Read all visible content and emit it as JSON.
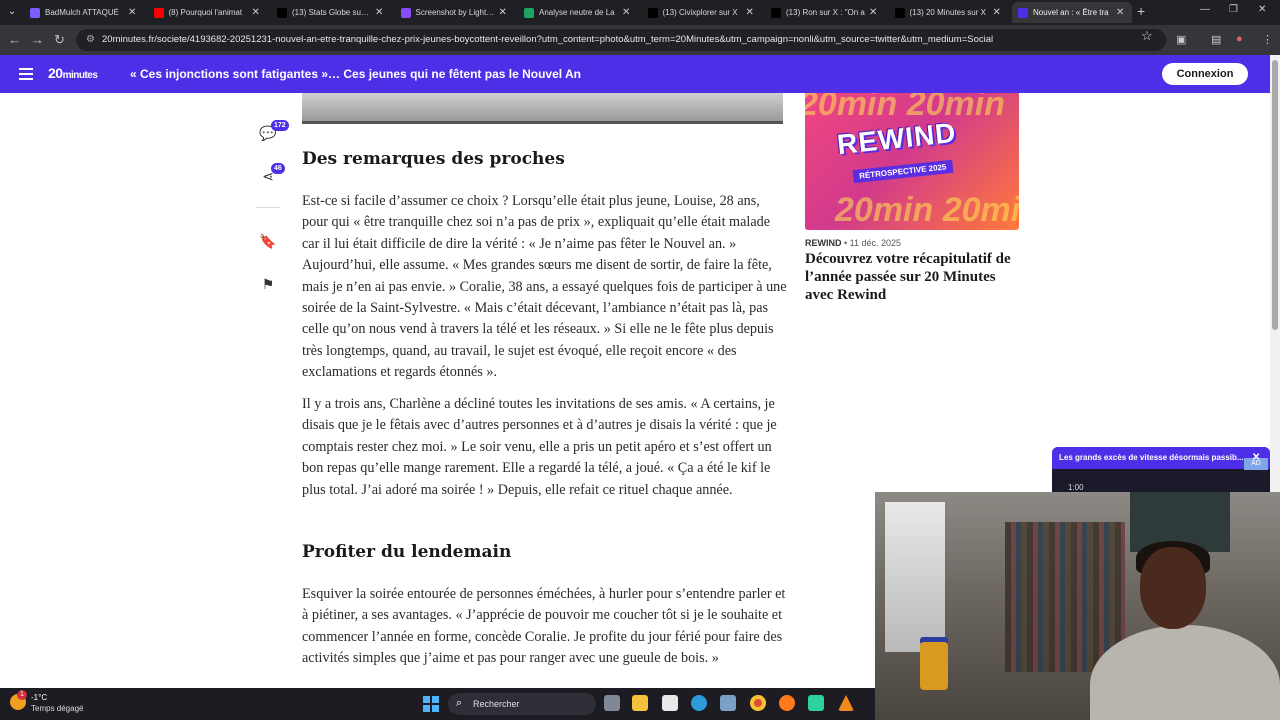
{
  "browser": {
    "tabs": [
      {
        "title": "BadMulch ATTAQUÉ",
        "color": "#7b5cff"
      },
      {
        "title": "(8) Pourquoi l'animat",
        "color": "#ff0000"
      },
      {
        "title": "(13) Stats Globe sur X",
        "color": "#000000"
      },
      {
        "title": "Screenshot by Lightsh",
        "color": "#8a4cf5"
      },
      {
        "title": "Analyse neutre de La",
        "color": "#1fa463"
      },
      {
        "title": "(13) Civixplorer sur X",
        "color": "#000000"
      },
      {
        "title": "(13) Ron sur X : \"On a",
        "color": "#000000"
      },
      {
        "title": "(13) 20 Minutes sur X",
        "color": "#000000"
      },
      {
        "title": "Nouvel an : « Être tra",
        "color": "#4f2ee8",
        "active": true
      }
    ],
    "url": "20minutes.fr/societe/4193682-20251231-nouvel-an-etre-tranquille-chez-prix-jeunes-boycottent-reveillon?utm_content=photo&utm_term=20Minutes&utm_campaign=nonli&utm_source=twitter&utm_medium=Social"
  },
  "site": {
    "logo_main": "20",
    "logo_sub": "minutes",
    "header_title": "« Ces injonctions sont fatigantes »… Ces jeunes qui ne fêtent pas le Nouvel An",
    "login_label": "Connexion",
    "brand_color": "#4f2ee8"
  },
  "rail": {
    "comments_count": "172",
    "shares_count": "46"
  },
  "article": {
    "heading1": "Des remarques des proches",
    "p1": "Est-ce si facile d’assumer ce choix ? Lorsqu’elle était plus jeune, Louise, 28 ans, pour qui « être tranquille chez soi n’a pas de prix », expliquait qu’elle était malade car il lui était difficile de dire la vérité : « Je n’aime pas fêter le Nouvel an. » Aujourd’hui, elle assume. « Mes grandes sœurs me disent de sortir, de faire la fête, mais je n’en ai pas envie. » Coralie, 38 ans, a essayé quelques fois de participer à une soirée de la Saint-Sylvestre. « Mais c’était décevant, l’ambiance n’était pas là, pas celle qu’on nous vend à travers la télé et les réseaux. » Si elle ne le fête plus depuis très longtemps, quand, au travail, le sujet est évoqué, elle reçoit encore « des exclamations et regards étonnés ».",
    "p2": "Il y a trois ans, Charlène a décliné toutes les invitations de ses amis. « A certains, je disais que je le fêtais avec d’autres personnes et à d’autres je disais la vérité : que je comptais rester chez moi. » Le soir venu, elle a pris un petit apéro et s’est offert un bon repas qu’elle mange rarement. Elle a regardé la télé, a joué. « Ça a été le kif le plus total. J’ai adoré ma soirée ! » Depuis, elle refait ce rituel chaque année.",
    "heading2": "Profiter du lendemain",
    "p3": "Esquiver la soirée entourée de personnes éméchées, à hurler pour s’entendre parler et à piétiner, a ses avantages. « J’apprécie de pouvoir me coucher tôt si je le souhaite et commencer l’année en forme, concède Coralie. Je profite du jour férié pour faire des activités simples que j’aime et pas pour ranger avec une gueule de bois. »"
  },
  "sidebar_card": {
    "image_word": "REWIND",
    "image_sub": "RÉTROSPECTIVE 2025",
    "category": "REWIND",
    "date": " • 11 déc. 2025",
    "title": "Découvrez votre récapitulatif de l’année passée sur 20 Minutes avec Rewind"
  },
  "floating_video": {
    "title": "Les grands excès de vitesse désormais passib...",
    "time": "1:00",
    "close": "✕",
    "ad": "AD"
  },
  "taskbar": {
    "weather_badge": "1",
    "temperature": "-1°C",
    "weather_desc": "Temps dégagé",
    "search_placeholder": "Rechercher"
  }
}
